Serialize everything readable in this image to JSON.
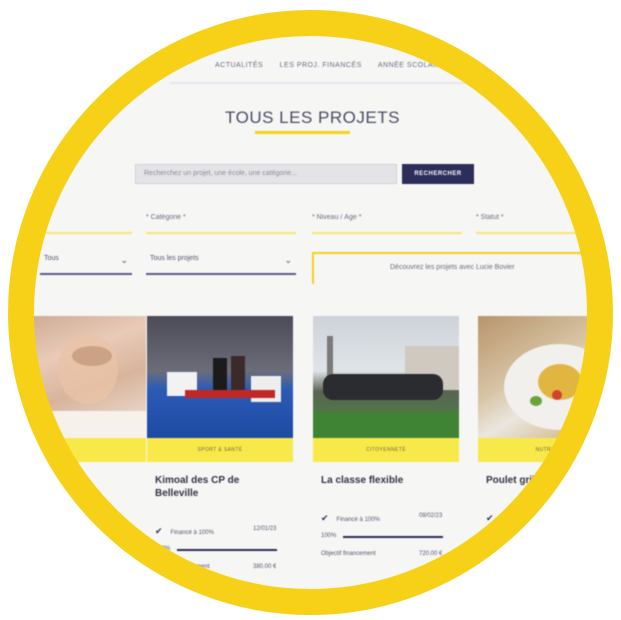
{
  "nav": {
    "item1": "ACTUALITÉS",
    "item2": "LES PROJ. FINANCÉS",
    "item3": "ANNÉE SCOLAIRE"
  },
  "page_title": "TOUS LES PROJETS",
  "search": {
    "placeholder": "Recherchez un projet, une école, une catégorie...",
    "button_label": "RECHERCHER"
  },
  "filters": {
    "category": "* Catégorie *",
    "level": "* Niveau / Âge *",
    "status": "* Statut *"
  },
  "dropdowns": {
    "left": "Tous",
    "mid": "Tous les projets"
  },
  "discover_label": "Découvrez les projets avec Lucie Bovier",
  "cards": [
    {
      "tag": "",
      "title": "",
      "meta_label": "",
      "meta_value": "",
      "bar_label": "",
      "meta2_label": "",
      "meta2_value": ""
    },
    {
      "tag": "SPORT & SANTÉ",
      "title": "Kimoal des CP de Belleville",
      "meta_label": "Financé à 100%",
      "meta_value": "12/01/23",
      "bar_label": "100%",
      "meta2_label": "Objectif financement",
      "meta2_value": "380.00 €"
    },
    {
      "tag": "CITOYENNETÉ",
      "title": "La classe flexible",
      "meta_label": "Financé à 100%",
      "meta_value": "08/02/23",
      "bar_label": "100%",
      "meta2_label": "Objectif financement",
      "meta2_value": "720.00 €"
    },
    {
      "tag": "NUTRITION",
      "title": "Poulet grillé à la cantine",
      "meta_label": "",
      "meta_value": "",
      "bar_label": "",
      "meta2_label": "",
      "meta2_value": ""
    }
  ],
  "colors": {
    "accent_yellow": "#f7d117",
    "navy": "#2b2d5a",
    "tag_yellow": "#f8e94b"
  }
}
